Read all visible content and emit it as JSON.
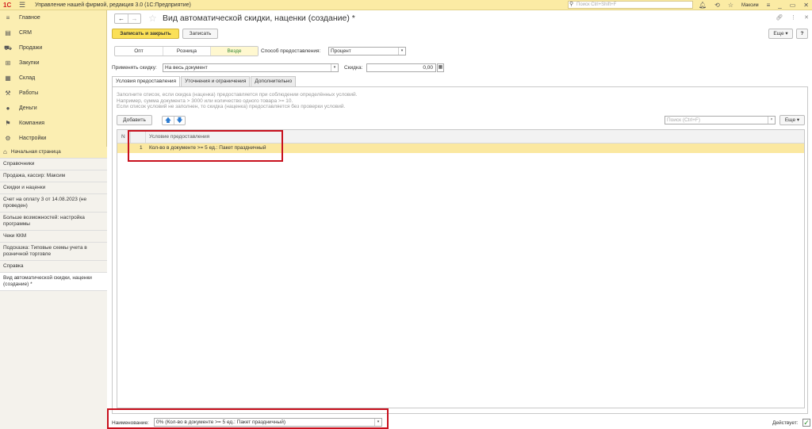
{
  "titlebar": {
    "logo": "1С",
    "app_title": "Управление нашей фирмой, редакция 3.0  (1С:Предприятие)",
    "search_placeholder": "Поиск Ctrl+Shift+F",
    "user": "Максим"
  },
  "sidebar": {
    "sections": [
      {
        "label": "Главное",
        "icon": "menu-icon"
      },
      {
        "label": "CRM",
        "icon": "crm-icon"
      },
      {
        "label": "Продажи",
        "icon": "sales-icon"
      },
      {
        "label": "Закупки",
        "icon": "purchases-icon"
      },
      {
        "label": "Склад",
        "icon": "warehouse-icon"
      },
      {
        "label": "Работы",
        "icon": "works-icon"
      },
      {
        "label": "Деньги",
        "icon": "money-icon"
      },
      {
        "label": "Компания",
        "icon": "company-icon"
      },
      {
        "label": "Настройки",
        "icon": "settings-icon"
      }
    ],
    "home": "Начальная страница",
    "open_items": [
      "Справочники",
      "Продажа, кассир: Максим",
      "Скидки и наценки",
      "Счет на оплату 3 от 14.08.2023 (не проведен)",
      "Больше возможностей: настройка программы",
      "Чеки ККМ",
      "Подсказка: Типовые схемы учета в розничной торговле",
      "Справка",
      "Вид автоматической скидки, наценки (создание) *"
    ]
  },
  "form": {
    "title": "Вид автоматической скидки, наценки (создание) *",
    "save_close": "Записать и закрыть",
    "save": "Записать",
    "more": "Еще",
    "help": "?",
    "modes": [
      "Опт",
      "Розница",
      "Везде"
    ],
    "selected_mode": "Везде",
    "method_label": "Способ предоставления:",
    "method_value": "Процент",
    "apply_label": "Применять скидку:",
    "apply_value": "На весь документ",
    "discount_label": "Скидка:",
    "discount_value": "0,00",
    "tabs": [
      "Условия предоставления",
      "Уточнения и ограничения",
      "Дополнительно"
    ],
    "hint_lines": [
      "Заполните список, если скидка (наценка) предоставляется при соблюдении определённых условий.",
      "Например, сумма документа > 3000 или количество одного товара >= 10.",
      "Если список условий не заполнен, то скидка (наценка) предоставляется без проверки условий."
    ],
    "add_button": "Добавить",
    "search_placeholder": "Поиск (Ctrl+F)",
    "grid_headers": {
      "n": "N",
      "condition": "Условие предоставления"
    },
    "rows": [
      {
        "n": "1",
        "condition": "Кол-во в документе >= 5 ед.: Пакет праздничный"
      }
    ],
    "name_label": "Наименование:",
    "name_value": "0% (Кол-во в документе >= 5 ед.: Пакет праздничный)",
    "active_label": "Действует:"
  }
}
